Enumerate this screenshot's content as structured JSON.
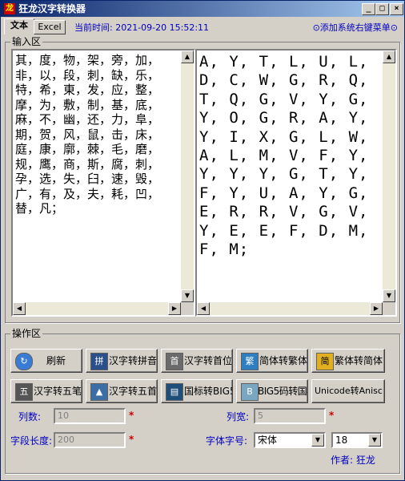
{
  "window": {
    "title": "狂龙汉字转换器",
    "app_icon": "dragon-app-icon",
    "controls": {
      "minimize": "_",
      "maximize": "□",
      "close": "×"
    }
  },
  "tabs": [
    {
      "label": "文本"
    },
    {
      "label": "Excel"
    }
  ],
  "header": {
    "timestamp": "当前时间: 2021-09-20    15:52:11",
    "context_menu_link": "⊙添加系统右键菜单⊙"
  },
  "input_area": {
    "title": "输入区",
    "source_text": "其，度，物，架，旁，加，非，以，段，刺，缺，乐，特，希，東，发，应，整，摩，为，敷，制，基，底，麻，不，幽，还，力，阜，期，贺，风，鼠，击，床，庭，康，廓，棘，毛，磨，规，鹰，商，斯，腐，刺，孕，选，失，臼，速，毁，广，有，及，夫，耗，凹，替，凡；",
    "result_text": "A, Y, T, L, U, L, D, C, W, G, R, Q, T, Q, G, V, Y, G, Y, O, G, R, A, Y, Y, I, X, G, L, W, A, L, M, V, F, Y, Y, Y, Y, G, T, Y, F, Y, U, A, Y, G, E, R, R, V, G, V, Y, E, E, F, D, M, F, M;"
  },
  "operation_area": {
    "title": "操作区",
    "buttons": [
      {
        "label": "刷新",
        "icon": "refresh-icon"
      },
      {
        "label": "汉字转拼音",
        "icon": "pinyin-icon"
      },
      {
        "label": "汉字转首位",
        "icon": "initial-icon"
      },
      {
        "label": "简体转繁体",
        "icon": "simp-to-trad-icon"
      },
      {
        "label": "繁体转简体",
        "icon": "trad-to-simp-icon"
      },
      {
        "label": "汉字转五笔",
        "icon": "wubi-icon"
      },
      {
        "label": "汉字转五首",
        "icon": "wubi-initial-icon"
      },
      {
        "label": "国标转BIG5",
        "icon": "gb-to-big5-icon"
      },
      {
        "label": "BIG5码转国标",
        "icon": "big5-to-gb-icon"
      },
      {
        "label": "Unicode转Anisc",
        "icon": "unicode-icon"
      }
    ],
    "columns": {
      "label": "列数:",
      "value": "10"
    },
    "column_width": {
      "label": "列宽:",
      "value": "5"
    },
    "field_length": {
      "label": "字段长度:",
      "value": "200"
    },
    "font": {
      "label": "字体字号:",
      "family": "宋体",
      "size": "18"
    },
    "required_mark": "*",
    "author": "作者: 狂龙"
  }
}
